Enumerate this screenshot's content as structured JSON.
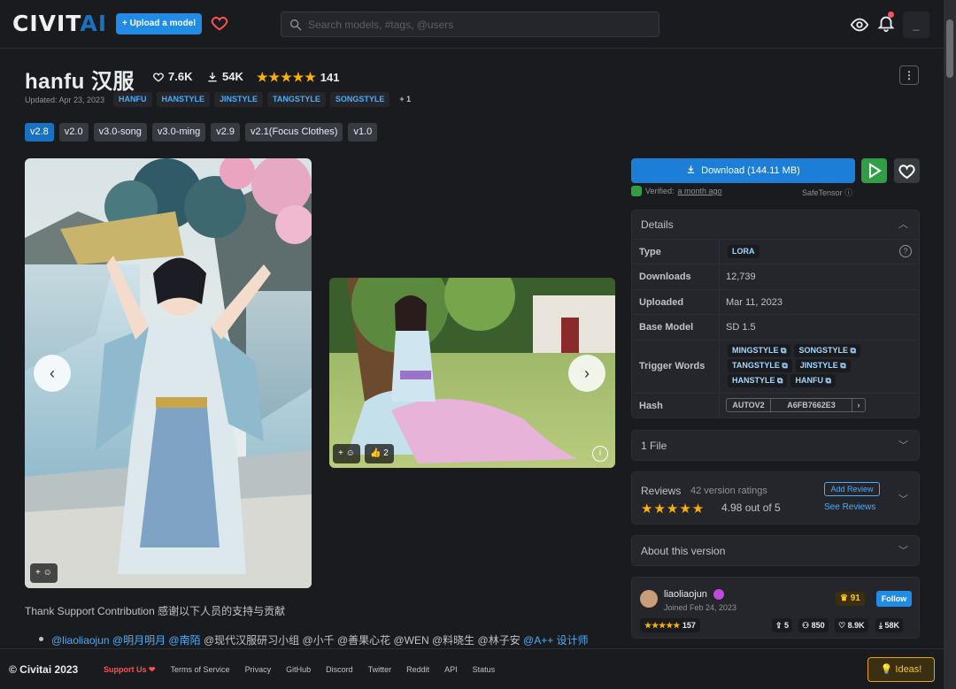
{
  "header": {
    "logo_left": "CIVIT",
    "logo_right": "AI",
    "upload_label": "+ Upload a model",
    "search_placeholder": "Search models, #tags, @users"
  },
  "model": {
    "title": "hanfu 汉服",
    "likes": "7.6K",
    "downloads": "54K",
    "rating_count": "141",
    "updated": "Updated: Apr 23, 2023",
    "tags": [
      "HANFU",
      "HANSTYLE",
      "JINSTYLE",
      "TANGSTYLE",
      "SONGSTYLE"
    ],
    "tags_more": "+ 1",
    "versions": [
      "v2.8",
      "v2.0",
      "v3.0-song",
      "v3.0-ming",
      "v2.9",
      "v2.1(Focus Clothes)",
      "v1.0"
    ]
  },
  "gallery": {
    "reaction2_count": "2"
  },
  "description": {
    "thanks": "Thank Support Contribution 感谢以下人员的支持与贡献",
    "credits_blue1": "@liaoliaojun @明月明月 @南陌",
    "credits_plain": "@现代汉服研习小组 @小千 @善果心花 @WEN @料晓生 @林子安",
    "credits_blue2": "@A++ 设计师"
  },
  "sidebar": {
    "download_label": "Download (144.11 MB)",
    "verified_prefix": "Verified:",
    "verified_when": "a month ago",
    "safetensor": "SafeTensor",
    "details_title": "Details",
    "type_label": "Type",
    "type_value": "LORA",
    "downloads_label": "Downloads",
    "downloads_value": "12,739",
    "uploaded_label": "Uploaded",
    "uploaded_value": "Mar 11, 2023",
    "base_model_label": "Base Model",
    "base_model_value": "SD 1.5",
    "trigger_label": "Trigger Words",
    "trigger_words": [
      "MINGSTYLE",
      "SONGSTYLE",
      "TANGSTYLE",
      "JINSTYLE",
      "HANSTYLE",
      "HANFU"
    ],
    "hash_label": "Hash",
    "hash_type": "AUTOV2",
    "hash_value": "A6FB7662E3",
    "files_title": "1 File",
    "reviews_title": "Reviews",
    "reviews_count": "42 version ratings",
    "reviews_score": "4.98 out of 5",
    "add_review": "Add Review",
    "see_reviews": "See Reviews",
    "about_title": "About this version",
    "creator_name": "liaoliaojun",
    "creator_joined": "Joined Feb 24, 2023",
    "creator_rank": "91",
    "follow_label": "Follow",
    "creator_rating_count": "157",
    "creator_uploads": "5",
    "creator_followers": "850",
    "creator_likes": "8.9K",
    "creator_downloads": "58K"
  },
  "footer": {
    "copyright": "© Civitai 2023",
    "support": "Support Us ❤",
    "links": [
      "Terms of Service",
      "Privacy",
      "GitHub",
      "Discord",
      "Twitter",
      "Reddit",
      "API",
      "Status"
    ],
    "ideas": "Ideas!"
  },
  "colors": {
    "accent": "#1c7ed6",
    "star": "#fab005",
    "brand_blue": "#228be6"
  }
}
